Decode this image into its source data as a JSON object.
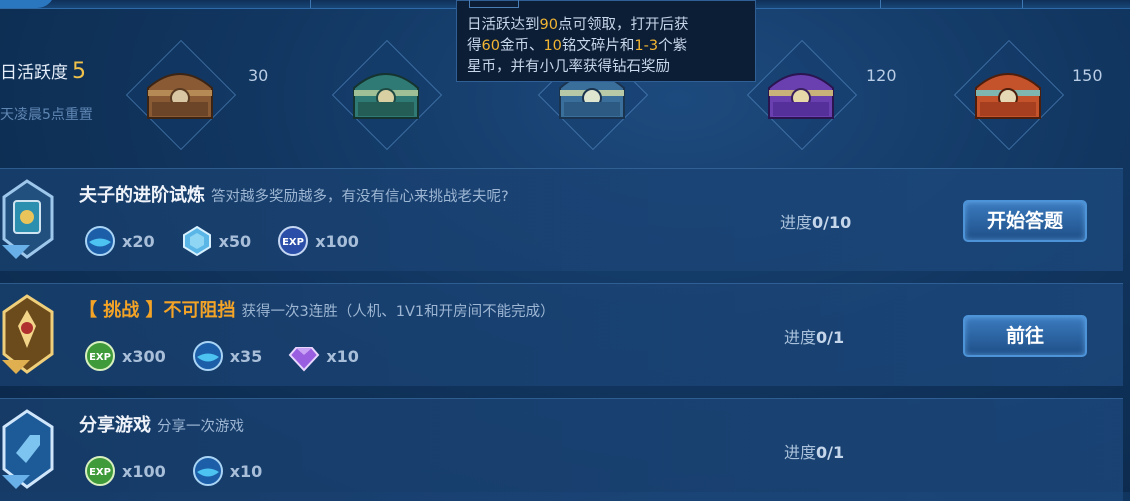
{
  "activity": {
    "label": "日活跃度",
    "value": "5",
    "reset_note": "天凌晨5点重置",
    "milestones": [
      "30",
      "120",
      "150"
    ]
  },
  "tooltip": {
    "line1_a": "日活跃达到",
    "line1_num": "90",
    "line1_b": "点可领取，打开后获",
    "line2_a": "得",
    "line2_num1": "60",
    "line2_b": "金币、",
    "line2_num2": "10",
    "line2_c": "铭文碎片和",
    "line2_num3": "1-3",
    "line2_d": "个紫",
    "line3": "星币，并有小几率获得钻石奖励"
  },
  "tasks": [
    {
      "title": "夫子的进阶试炼",
      "desc": "答对越多奖励越多，有没有信心来挑战老夫呢?",
      "rewards": [
        {
          "icon": "blue-orb-icon",
          "qty": "x20"
        },
        {
          "icon": "blue-crystal-icon",
          "qty": "x50"
        },
        {
          "icon": "exp-blue-icon",
          "qty": "x100"
        }
      ],
      "progress_label": "进度",
      "progress_value": "0/10",
      "button": "开始答题"
    },
    {
      "title_open": "【 挑战 】",
      "title": "不可阻挡",
      "desc": "获得一次3连胜（人机、1V1和开房间不能完成）",
      "rewards": [
        {
          "icon": "exp-green-icon",
          "qty": "x300"
        },
        {
          "icon": "blue-orb-icon",
          "qty": "x35"
        },
        {
          "icon": "purple-gem-icon",
          "qty": "x10"
        }
      ],
      "progress_label": "进度",
      "progress_value": "0/1",
      "button": "前往"
    },
    {
      "title": "分享游戏",
      "desc": "分享一次游戏",
      "rewards": [
        {
          "icon": "exp-green-icon",
          "qty": "x100"
        },
        {
          "icon": "blue-orb-icon",
          "qty": "x10"
        }
      ],
      "progress_label": "进度",
      "progress_value": "0/1"
    }
  ],
  "colors": {
    "accent_gold": "#f0c24a",
    "highlight_orange": "#f3a326",
    "button_blue": "#2d6aad"
  }
}
